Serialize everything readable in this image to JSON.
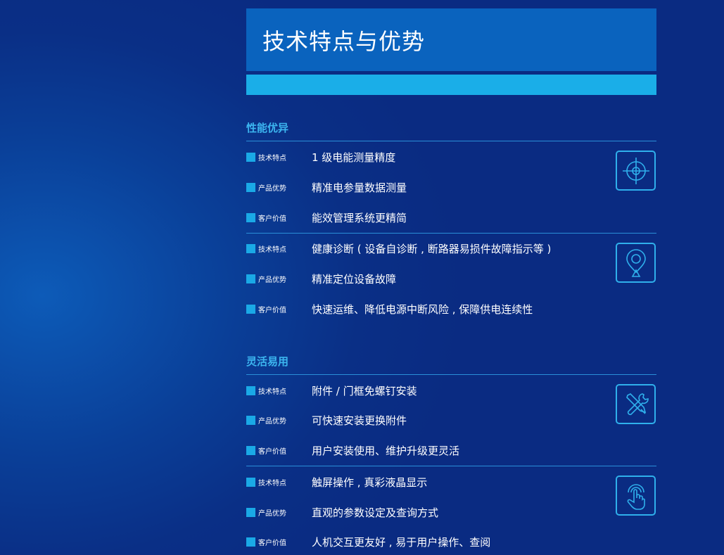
{
  "title": "技术特点与优势",
  "sections": [
    {
      "heading": "性能优异"
    },
    {
      "heading": "灵活易用"
    }
  ],
  "groups": [
    {
      "icon": "crosshair-icon",
      "rows": [
        {
          "label": "技术特点",
          "text": "1 级电能测量精度"
        },
        {
          "label": "产品优势",
          "text": "精准电参量数据测量"
        },
        {
          "label": "客户价值",
          "text": "能效管理系统更精简"
        }
      ]
    },
    {
      "icon": "location-diagnosis-icon",
      "rows": [
        {
          "label": "技术特点",
          "text": "健康诊断 ( 设备自诊断 , 断路器易损件故障指示等 )"
        },
        {
          "label": "产品优势",
          "text": "精准定位设备故障"
        },
        {
          "label": "客户价值",
          "text": "快速运维、降低电源中断风险 , 保障供电连续性"
        }
      ]
    },
    {
      "icon": "tools-icon",
      "rows": [
        {
          "label": "技术特点",
          "text": "附件 / 门框免螺钉安装"
        },
        {
          "label": "产品优势",
          "text": "可快速安装更换附件"
        },
        {
          "label": "客户价值",
          "text": "用户安装使用、维护升级更灵活"
        }
      ]
    },
    {
      "icon": "touch-hand-icon",
      "rows": [
        {
          "label": "技术特点",
          "text": "触屏操作 , 真彩液晶显示"
        },
        {
          "label": "产品优势",
          "text": "直观的参数设定及查询方式"
        },
        {
          "label": "客户价值",
          "text": "人机交互更友好 , 易于用户操作、查阅"
        }
      ]
    }
  ],
  "colors": {
    "accent": "#1aaee8",
    "header": "#0a63be",
    "heading_text": "#3cb6f0"
  }
}
